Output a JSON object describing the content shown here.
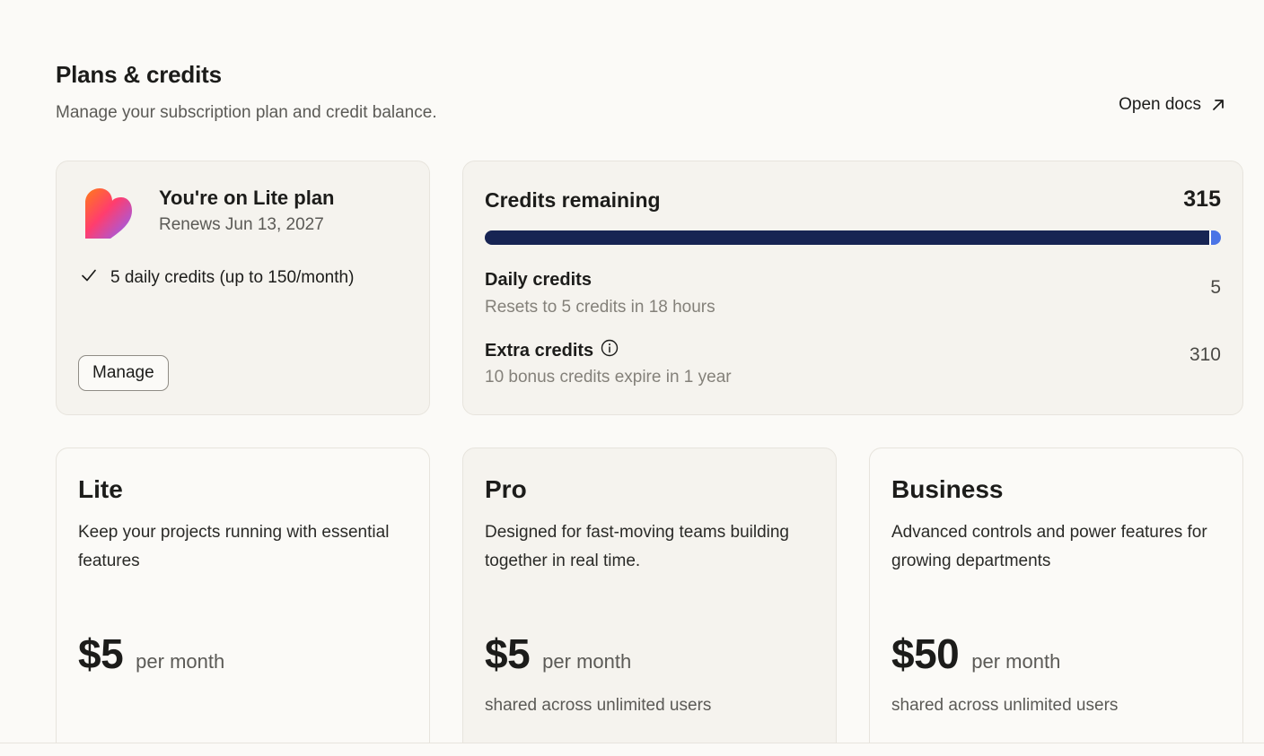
{
  "header": {
    "title": "Plans & credits",
    "subtitle": "Manage your subscription plan and credit balance.",
    "open_docs_label": "Open docs"
  },
  "plan": {
    "name": "You're on Lite plan",
    "renews": "Renews Jun 13, 2027",
    "feature": "5 daily credits (up to 150/month)",
    "manage_label": "Manage"
  },
  "credits": {
    "title": "Credits remaining",
    "total": "315",
    "progress": {
      "extra_fraction": 0.984,
      "daily_fraction": 0.016
    },
    "daily": {
      "label": "Daily credits",
      "sub": "Resets to 5 credits in 18 hours",
      "value": "5"
    },
    "extra": {
      "label": "Extra credits",
      "sub": "10 bonus credits expire in 1 year",
      "value": "310"
    },
    "colors": {
      "extra": "#172453",
      "daily": "#4b74e6"
    }
  },
  "pricing": [
    {
      "name": "Lite",
      "description": "Keep your projects running with essential features",
      "price": "$5",
      "period": "per month",
      "note": ""
    },
    {
      "name": "Pro",
      "description": "Designed for fast-moving teams building together in real time.",
      "price": "$5",
      "period": "per month",
      "note": "shared across unlimited users"
    },
    {
      "name": "Business",
      "description": "Advanced controls and power features for growing departments",
      "price": "$50",
      "period": "per month",
      "note": "shared across unlimited users"
    }
  ],
  "icons": {
    "open_docs": "arrow-up-right-icon",
    "plan_logo": "heart-logo-icon",
    "feature_check": "check-icon",
    "extra_info": "info-icon"
  }
}
